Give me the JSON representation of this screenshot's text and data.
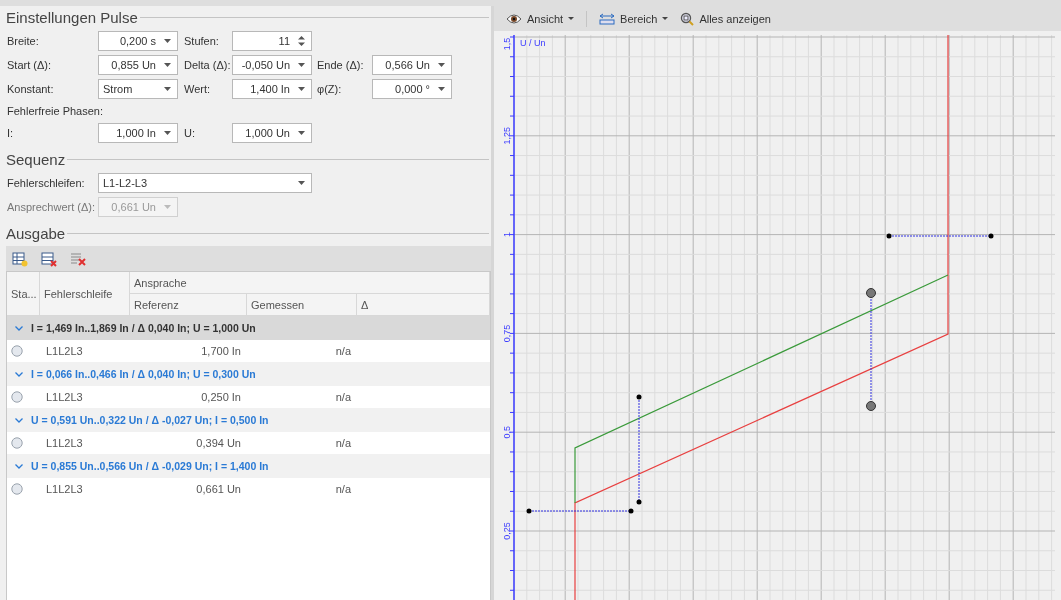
{
  "pulse_settings": {
    "title": "Einstellungen Pulse",
    "rows": [
      {
        "kind": "fields",
        "fields": [
          {
            "label": "Breite:",
            "value": "0,200 s",
            "kind": "dropdown",
            "disabled": false
          },
          {
            "label": "Stufen:",
            "value": "11",
            "kind": "spin",
            "disabled": false
          }
        ]
      },
      {
        "kind": "fields",
        "fields": [
          {
            "label": "Start (Δ):",
            "value": "0,855 Un",
            "kind": "dropdown",
            "disabled": false
          },
          {
            "label": "Delta (Δ):",
            "value": "-0,050 Un",
            "kind": "dropdown",
            "disabled": false
          },
          {
            "label": "Ende (Δ):",
            "value": "0,566 Un",
            "kind": "dropdown",
            "disabled": false
          }
        ]
      },
      {
        "kind": "fields",
        "fields": [
          {
            "label": "Konstant:",
            "value": "Strom",
            "kind": "combo",
            "disabled": false
          },
          {
            "label": "Wert:",
            "value": "1,400 In",
            "kind": "dropdown",
            "disabled": false
          },
          {
            "label": "φ(Z):",
            "value": "0,000 °",
            "kind": "dropdown",
            "disabled": false
          }
        ]
      },
      {
        "kind": "note",
        "text": "Fehlerfreie Phasen:"
      },
      {
        "kind": "fields",
        "fields": [
          {
            "label": "I:",
            "value": "1,000 In",
            "kind": "dropdown",
            "disabled": false
          },
          {
            "label": "U:",
            "value": "1,000 Un",
            "kind": "dropdown",
            "disabled": false
          }
        ]
      }
    ]
  },
  "sequence": {
    "title": "Sequenz",
    "rows": [
      {
        "kind": "fields",
        "fields": [
          {
            "label": "Fehlerschleifen:",
            "value": "L1-L2-L3",
            "kind": "wide",
            "disabled": false
          }
        ]
      },
      {
        "kind": "fields",
        "fields": [
          {
            "label": "Ansprechwert (Δ):",
            "value": "0,661 Un",
            "kind": "dropdown",
            "disabled": true
          }
        ]
      }
    ]
  },
  "output": {
    "title": "Ausgabe",
    "columns": {
      "status": "Sta...",
      "loop": "Fehlerschleife",
      "group": "Ansprache",
      "reference": "Referenz",
      "measured": "Gemessen",
      "delta": "Δ"
    },
    "groups": [
      {
        "title": "I = 1,469 In..1,869 In / Δ 0,040 In; U = 1,000 Un",
        "expanded": true,
        "selected": true,
        "rows": [
          {
            "loop": "L1L2L3",
            "reference": "1,700 In",
            "measured": "n/a"
          }
        ]
      },
      {
        "title": "I = 0,066 In..0,466 In / Δ 0,040 In; U = 0,300 Un",
        "expanded": true,
        "selected": false,
        "rows": [
          {
            "loop": "L1L2L3",
            "reference": "0,250 In",
            "measured": "n/a"
          }
        ]
      },
      {
        "title": "U = 0,591 Un..0,322 Un / Δ -0,027 Un; I = 0,500 In",
        "expanded": true,
        "selected": false,
        "rows": [
          {
            "loop": "L1L2L3",
            "reference": "0,394 Un",
            "measured": "n/a"
          }
        ]
      },
      {
        "title": "U = 0,855 Un..0,566 Un / Δ -0,029 Un; I = 1,400 In",
        "expanded": true,
        "selected": false,
        "rows": [
          {
            "loop": "L1L2L3",
            "reference": "0,661 Un",
            "measured": "n/a"
          }
        ]
      }
    ]
  },
  "chart_toolbar": [
    {
      "label": "Ansicht",
      "kind": "view",
      "menu": true
    },
    {
      "label": "Bereich",
      "kind": "range",
      "menu": true
    },
    {
      "label": "Alles anzeigen",
      "kind": "zoom",
      "menu": false
    }
  ],
  "chart": {
    "axis_label": "U / Un",
    "y_ticks": [
      "1,5",
      "1,25",
      "1",
      "0,75",
      "0,5",
      "0,25"
    ]
  }
}
